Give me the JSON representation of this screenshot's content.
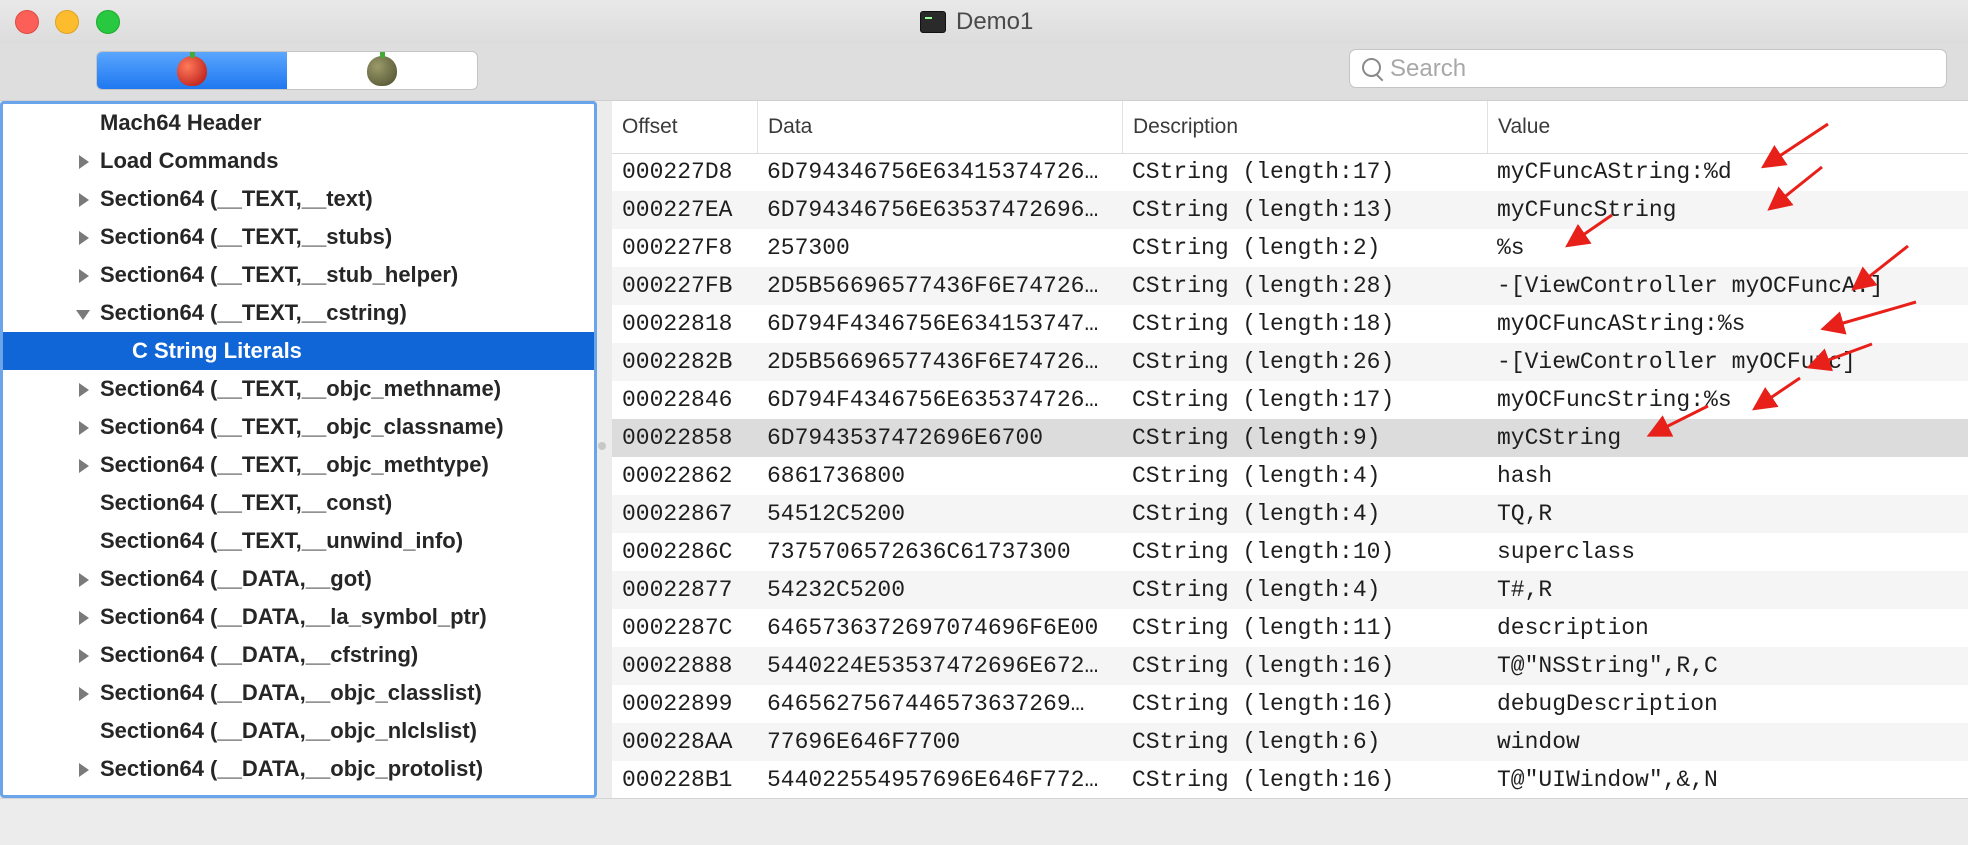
{
  "window": {
    "title": "Demo1"
  },
  "toolbar": {
    "segments": [
      {
        "name": "red-apple-icon",
        "selected": true
      },
      {
        "name": "gray-apple-icon",
        "selected": false
      }
    ],
    "search": {
      "placeholder": "Search",
      "value": ""
    }
  },
  "sidebar": {
    "items": [
      {
        "label": "Mach64 Header",
        "disclosure": "none",
        "level": 0,
        "selected": false
      },
      {
        "label": "Load Commands",
        "disclosure": "collapsed",
        "level": 0,
        "selected": false
      },
      {
        "label": "Section64 (__TEXT,__text)",
        "disclosure": "collapsed",
        "level": 0,
        "selected": false
      },
      {
        "label": "Section64 (__TEXT,__stubs)",
        "disclosure": "collapsed",
        "level": 0,
        "selected": false
      },
      {
        "label": "Section64 (__TEXT,__stub_helper)",
        "disclosure": "collapsed",
        "level": 0,
        "selected": false
      },
      {
        "label": "Section64 (__TEXT,__cstring)",
        "disclosure": "expanded",
        "level": 0,
        "selected": false
      },
      {
        "label": "C String Literals",
        "disclosure": "none",
        "level": 1,
        "selected": true
      },
      {
        "label": "Section64 (__TEXT,__objc_methname)",
        "disclosure": "collapsed",
        "level": 0,
        "selected": false
      },
      {
        "label": "Section64 (__TEXT,__objc_classname)",
        "disclosure": "collapsed",
        "level": 0,
        "selected": false
      },
      {
        "label": "Section64 (__TEXT,__objc_methtype)",
        "disclosure": "collapsed",
        "level": 0,
        "selected": false
      },
      {
        "label": "Section64 (__TEXT,__const)",
        "disclosure": "none",
        "level": 0,
        "selected": false
      },
      {
        "label": "Section64 (__TEXT,__unwind_info)",
        "disclosure": "none",
        "level": 0,
        "selected": false
      },
      {
        "label": "Section64 (__DATA,__got)",
        "disclosure": "collapsed",
        "level": 0,
        "selected": false
      },
      {
        "label": "Section64 (__DATA,__la_symbol_ptr)",
        "disclosure": "collapsed",
        "level": 0,
        "selected": false
      },
      {
        "label": "Section64 (__DATA,__cfstring)",
        "disclosure": "collapsed",
        "level": 0,
        "selected": false
      },
      {
        "label": "Section64 (__DATA,__objc_classlist)",
        "disclosure": "collapsed",
        "level": 0,
        "selected": false
      },
      {
        "label": "Section64 (__DATA,__objc_nlclslist)",
        "disclosure": "none",
        "level": 0,
        "selected": false
      },
      {
        "label": "Section64 (__DATA,__objc_protolist)",
        "disclosure": "collapsed",
        "level": 0,
        "selected": false
      }
    ]
  },
  "table": {
    "columns": [
      "Offset",
      "Data",
      "Description",
      "Value"
    ],
    "highlighted_row": 7,
    "rows": [
      [
        "000227D8",
        "6D794346756E63415374726…",
        "CString (length:17)",
        "myCFuncAString:%d"
      ],
      [
        "000227EA",
        "6D794346756E63537472696…",
        "CString (length:13)",
        "myCFuncString"
      ],
      [
        "000227F8",
        "257300",
        "CString (length:2)",
        "%s"
      ],
      [
        "000227FB",
        "2D5B56696577436F6E74726…",
        "CString (length:28)",
        "-[ViewController myOCFuncA:]"
      ],
      [
        "00022818",
        "6D794F4346756E634153747…",
        "CString (length:18)",
        "myOCFuncAString:%s"
      ],
      [
        "0002282B",
        "2D5B56696577436F6E74726…",
        "CString (length:26)",
        "-[ViewController myOCFunc]"
      ],
      [
        "00022846",
        "6D794F4346756E635374726…",
        "CString (length:17)",
        "myOCFuncString:%s"
      ],
      [
        "00022858",
        "6D7943537472696E6700",
        "CString (length:9)",
        "myCString"
      ],
      [
        "00022862",
        "6861736800",
        "CString (length:4)",
        "hash"
      ],
      [
        "00022867",
        "54512C5200",
        "CString (length:4)",
        "TQ,R"
      ],
      [
        "0002286C",
        "7375706572636C61737300",
        "CString (length:10)",
        "superclass"
      ],
      [
        "00022877",
        "54232C5200",
        "CString (length:4)",
        "T#,R"
      ],
      [
        "0002287C",
        "6465736372697074696F6E00",
        "CString (length:11)",
        "description"
      ],
      [
        "00022888",
        "5440224E53537472696E672…",
        "CString (length:16)",
        "T@\"NSString\",R,C"
      ],
      [
        "00022899",
        "6465627567446573637269…",
        "CString (length:16)",
        "debugDescription"
      ],
      [
        "000228AA",
        "77696E646F7700",
        "CString (length:6)",
        "window"
      ],
      [
        "000228B1",
        "544022554957696E646F772…",
        "CString (length:16)",
        "T@\"UIWindow\",&,N"
      ]
    ]
  },
  "annotations": {
    "arrow_color": "#e8201a",
    "arrow_count": 8
  }
}
